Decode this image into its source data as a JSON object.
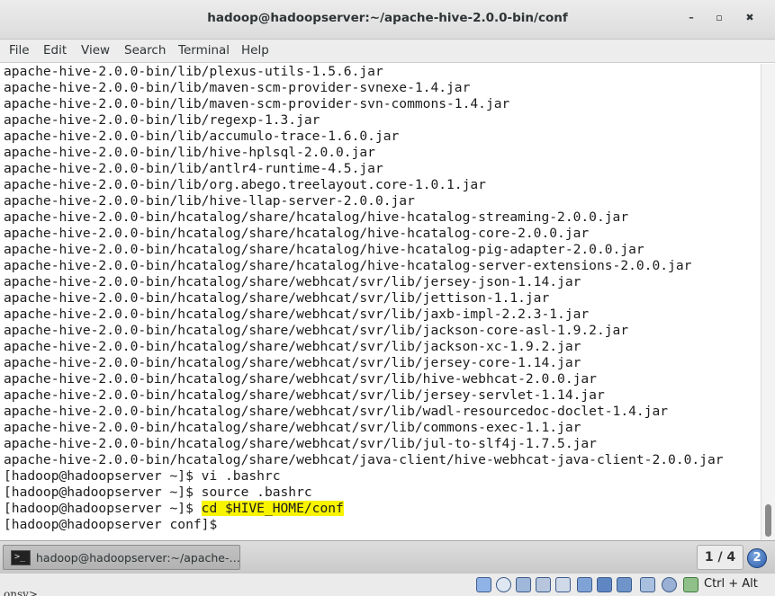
{
  "window": {
    "title": "hadoop@hadoopserver:~/apache-hive-2.0.0-bin/conf",
    "minimize_glyph": "–",
    "maximize_glyph": "▫",
    "close_glyph": "✖"
  },
  "menu": [
    "File",
    "Edit",
    "View",
    "Search",
    "Terminal",
    "Help"
  ],
  "terminal": {
    "lines": [
      "apache-hive-2.0.0-bin/lib/plexus-utils-1.5.6.jar",
      "apache-hive-2.0.0-bin/lib/maven-scm-provider-svnexe-1.4.jar",
      "apache-hive-2.0.0-bin/lib/maven-scm-provider-svn-commons-1.4.jar",
      "apache-hive-2.0.0-bin/lib/regexp-1.3.jar",
      "apache-hive-2.0.0-bin/lib/accumulo-trace-1.6.0.jar",
      "apache-hive-2.0.0-bin/lib/hive-hplsql-2.0.0.jar",
      "apache-hive-2.0.0-bin/lib/antlr4-runtime-4.5.jar",
      "apache-hive-2.0.0-bin/lib/org.abego.treelayout.core-1.0.1.jar",
      "apache-hive-2.0.0-bin/lib/hive-llap-server-2.0.0.jar",
      "apache-hive-2.0.0-bin/hcatalog/share/hcatalog/hive-hcatalog-streaming-2.0.0.jar",
      "apache-hive-2.0.0-bin/hcatalog/share/hcatalog/hive-hcatalog-core-2.0.0.jar",
      "apache-hive-2.0.0-bin/hcatalog/share/hcatalog/hive-hcatalog-pig-adapter-2.0.0.jar",
      "apache-hive-2.0.0-bin/hcatalog/share/hcatalog/hive-hcatalog-server-extensions-2.0.0.jar",
      "apache-hive-2.0.0-bin/hcatalog/share/webhcat/svr/lib/jersey-json-1.14.jar",
      "apache-hive-2.0.0-bin/hcatalog/share/webhcat/svr/lib/jettison-1.1.jar",
      "apache-hive-2.0.0-bin/hcatalog/share/webhcat/svr/lib/jaxb-impl-2.2.3-1.jar",
      "apache-hive-2.0.0-bin/hcatalog/share/webhcat/svr/lib/jackson-core-asl-1.9.2.jar",
      "apache-hive-2.0.0-bin/hcatalog/share/webhcat/svr/lib/jackson-xc-1.9.2.jar",
      "apache-hive-2.0.0-bin/hcatalog/share/webhcat/svr/lib/jersey-core-1.14.jar",
      "apache-hive-2.0.0-bin/hcatalog/share/webhcat/svr/lib/hive-webhcat-2.0.0.jar",
      "apache-hive-2.0.0-bin/hcatalog/share/webhcat/svr/lib/jersey-servlet-1.14.jar",
      "apache-hive-2.0.0-bin/hcatalog/share/webhcat/svr/lib/wadl-resourcedoc-doclet-1.4.jar",
      "apache-hive-2.0.0-bin/hcatalog/share/webhcat/svr/lib/commons-exec-1.1.jar",
      "apache-hive-2.0.0-bin/hcatalog/share/webhcat/svr/lib/jul-to-slf4j-1.7.5.jar",
      "apache-hive-2.0.0-bin/hcatalog/share/webhcat/java-client/hive-webhcat-java-client-2.0.0.jar",
      "[hadoop@hadoopserver ~]$ vi .bashrc",
      "[hadoop@hadoopserver ~]$ source .bashrc"
    ],
    "highlight_prompt": "[hadoop@hadoopserver ~]$ ",
    "highlight_command": "cd $HIVE_HOME/conf",
    "current_prompt": "[hadoop@hadoopserver conf]$ ",
    "highlight_color": "#f8f400"
  },
  "taskbar": {
    "task_label": "hadoop@hadoopserver:~/apache-…",
    "task_icon_text": ">_",
    "workspace": "1 / 4",
    "help_glyph": "2"
  },
  "statusbar": {
    "host_key": "Ctrl + Alt",
    "left_fragment": "onsv>",
    "icons": [
      "hdd-icon",
      "optical-disc-icon",
      "usb-icon",
      "audio-icon",
      "pen-icon",
      "network-icon",
      "display-icon",
      "shared-folder-icon",
      "video-capture-icon",
      "settings-icon",
      "down-arrow-icon"
    ]
  }
}
